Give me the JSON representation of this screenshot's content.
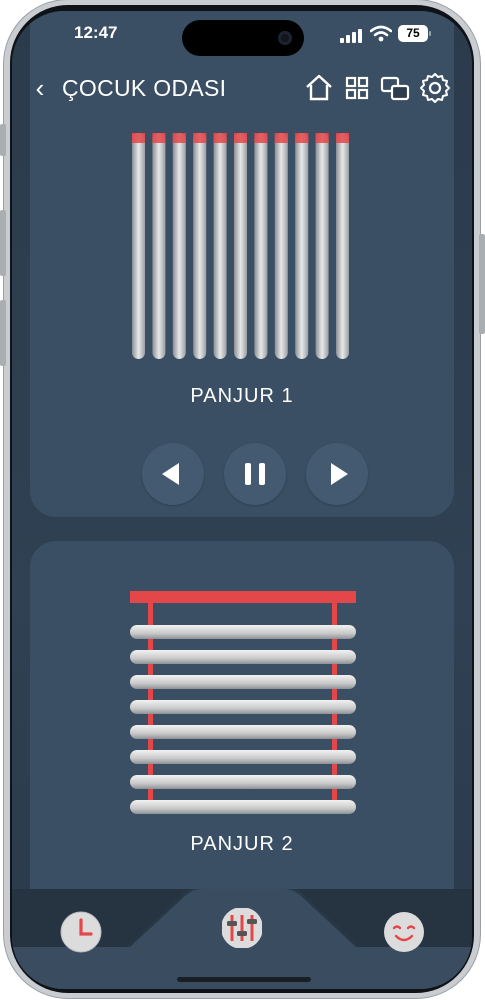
{
  "status": {
    "time": "12:47",
    "battery": "75"
  },
  "header": {
    "title": "ÇOCUK ODASI"
  },
  "blinds": [
    {
      "label": "PANJUR  1"
    },
    {
      "label": "PANJUR  2"
    }
  ],
  "colors": {
    "accent": "#e4474a",
    "card": "#3a4f63",
    "background": "#2b3b4b",
    "slat": "#d9d9d9"
  },
  "icons": [
    "back-icon",
    "home-icon",
    "grid-icon",
    "scenes-icon",
    "gear-icon",
    "left-arrow-icon",
    "pause-icon",
    "right-arrow-icon",
    "clock-icon",
    "sliders-icon",
    "smiley-icon"
  ]
}
